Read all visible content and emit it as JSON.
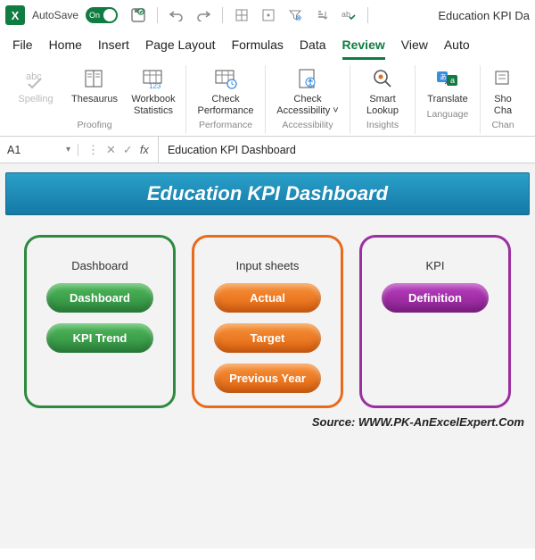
{
  "titlebar": {
    "autosave_label": "AutoSave",
    "autosave_state": "On",
    "document_title": "Education KPI Da"
  },
  "tabs": {
    "items": [
      "File",
      "Home",
      "Insert",
      "Page Layout",
      "Formulas",
      "Data",
      "Review",
      "View",
      "Auto"
    ],
    "active_index": 6
  },
  "ribbon": {
    "groups": [
      {
        "label": "Proofing",
        "buttons": [
          {
            "label": "Spelling",
            "icon": "spelling-icon",
            "disabled": true
          },
          {
            "label": "Thesaurus",
            "icon": "thesaurus-icon"
          },
          {
            "label": "Workbook Statistics",
            "icon": "stats-icon"
          }
        ]
      },
      {
        "label": "Performance",
        "buttons": [
          {
            "label": "Check Performance",
            "icon": "performance-icon"
          }
        ]
      },
      {
        "label": "Accessibility",
        "buttons": [
          {
            "label": "Check Accessibility ˅",
            "icon": "accessibility-icon"
          }
        ]
      },
      {
        "label": "Insights",
        "buttons": [
          {
            "label": "Smart Lookup",
            "icon": "lookup-icon"
          }
        ]
      },
      {
        "label": "Language",
        "buttons": [
          {
            "label": "Translate",
            "icon": "translate-icon"
          }
        ]
      },
      {
        "label": "Chan",
        "buttons": [
          {
            "label": "Sho Cha",
            "icon": "changes-icon"
          }
        ]
      }
    ]
  },
  "formula_bar": {
    "name_box": "A1",
    "content": "Education KPI Dashboard"
  },
  "dashboard": {
    "title": "Education KPI Dashboard",
    "panels": [
      {
        "legend": "Dashboard",
        "class": "green",
        "pills": [
          "Dashboard",
          "KPI Trend"
        ]
      },
      {
        "legend": "Input sheets",
        "class": "orange",
        "pills": [
          "Actual",
          "Target",
          "Previous Year"
        ]
      },
      {
        "legend": "KPI",
        "class": "purple",
        "pills": [
          "Definition"
        ]
      }
    ],
    "source": "Source: WWW.PK-AnExcelExpert.Com"
  }
}
